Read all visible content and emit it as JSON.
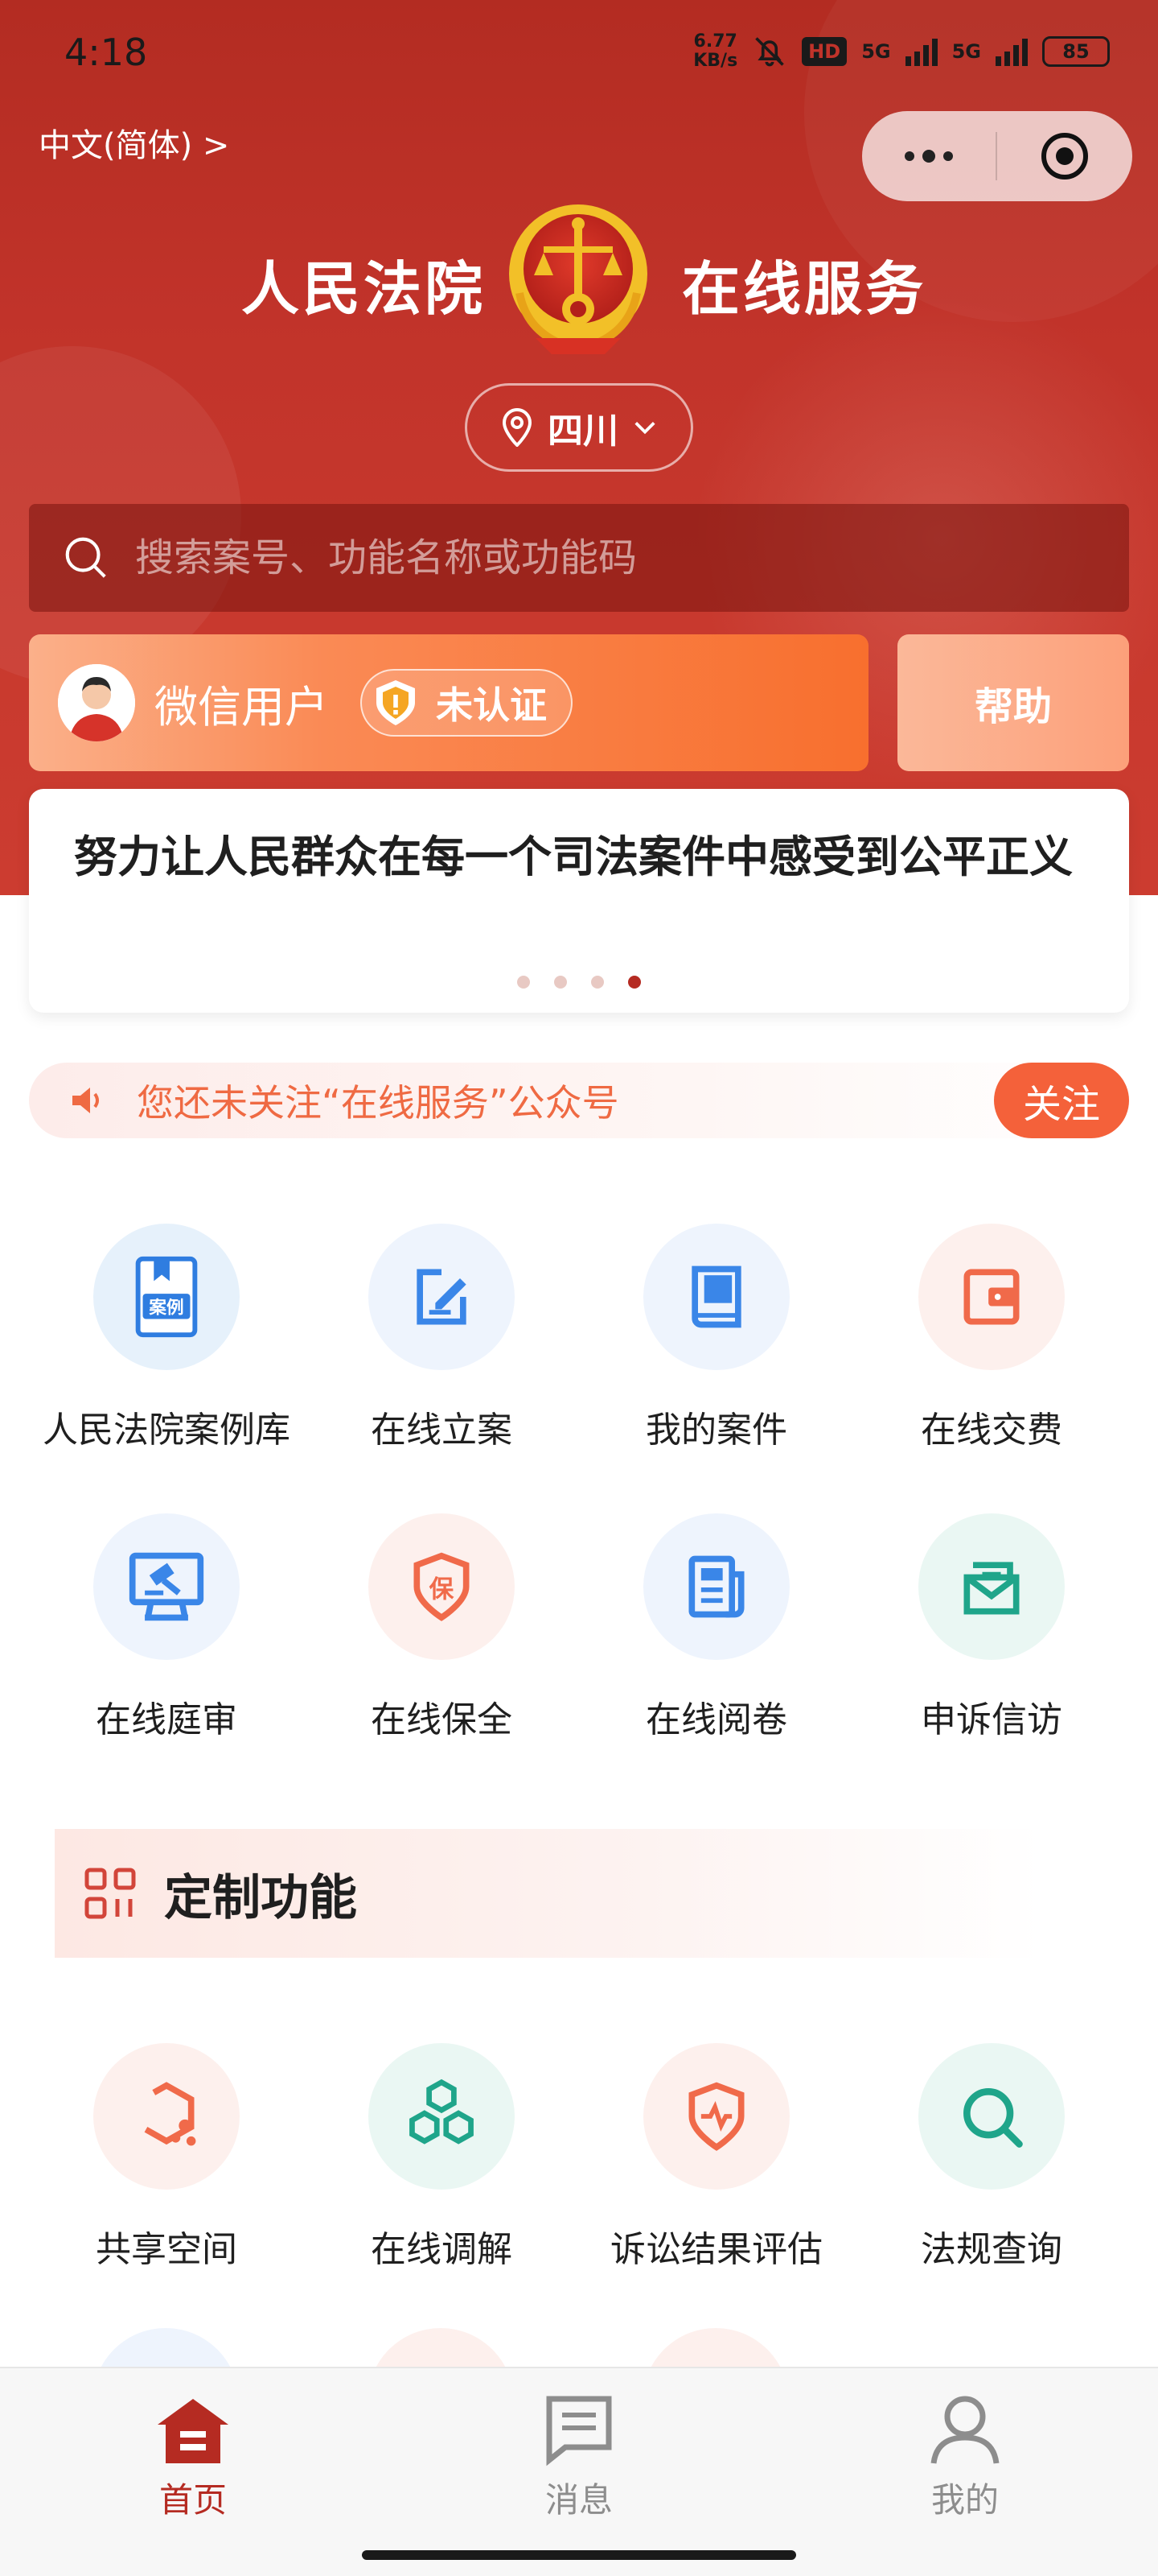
{
  "status_bar": {
    "time": "4:18",
    "net_speed_value": "6.77",
    "net_speed_unit": "KB/s",
    "hd": "HD",
    "signal1": "5G",
    "signal2": "5G",
    "battery": "85"
  },
  "header": {
    "language": "中文(简体) >",
    "title_left": "人民法院",
    "title_right": "在线服务",
    "region": "四川"
  },
  "search": {
    "placeholder": "搜索案号、功能名称或功能码"
  },
  "user": {
    "name": "微信用户",
    "verify_status": "未认证",
    "help_label": "帮助"
  },
  "banner": {
    "slogan": "努力让人民群众在每一个司法案件中感受到公平正义",
    "dots_count": 4,
    "active_dot": 4
  },
  "follow_bar": {
    "text": "您还未关注“在线服务”公众号",
    "button": "关注"
  },
  "services": [
    {
      "label": "人民法院案例库",
      "icon": "case-library-icon",
      "color": "#2f7de0",
      "bg": "#e6f1fb"
    },
    {
      "label": "在线立案",
      "icon": "filing-edit-icon",
      "color": "#3a86e8",
      "bg": "#eef4fd"
    },
    {
      "label": "我的案件",
      "icon": "book-icon",
      "color": "#3a86e8",
      "bg": "#eef4fd"
    },
    {
      "label": "在线交费",
      "icon": "wallet-icon",
      "color": "#f06a4a",
      "bg": "#fdf0ed"
    },
    {
      "label": "在线庭审",
      "icon": "gavel-screen-icon",
      "color": "#3a86e8",
      "bg": "#eef4fd"
    },
    {
      "label": "在线保全",
      "icon": "shield-bao-icon",
      "color": "#f06a4a",
      "bg": "#fdf0ed"
    },
    {
      "label": "在线阅卷",
      "icon": "newspaper-icon",
      "color": "#3a86e8",
      "bg": "#eef4fd"
    },
    {
      "label": "申诉信访",
      "icon": "mailbox-icon",
      "color": "#1fa58a",
      "bg": "#eaf7f3"
    }
  ],
  "custom_section": {
    "title": "定制功能"
  },
  "custom_features": [
    {
      "label": "共享空间",
      "icon": "hexagon-share-icon",
      "color": "#f06a4a",
      "bg": "#fdf0ed"
    },
    {
      "label": "在线调解",
      "icon": "three-hexagons-icon",
      "color": "#1fa58a",
      "bg": "#eaf7f3"
    },
    {
      "label": "诉讼结果评估",
      "icon": "shield-pulse-icon",
      "color": "#f06a4a",
      "bg": "#fdf0ed"
    },
    {
      "label": "法规查询",
      "icon": "search-icon",
      "color": "#1fa58a",
      "bg": "#eaf7f3"
    }
  ],
  "tabbar": {
    "home": "首页",
    "messages": "消息",
    "mine": "我的"
  }
}
